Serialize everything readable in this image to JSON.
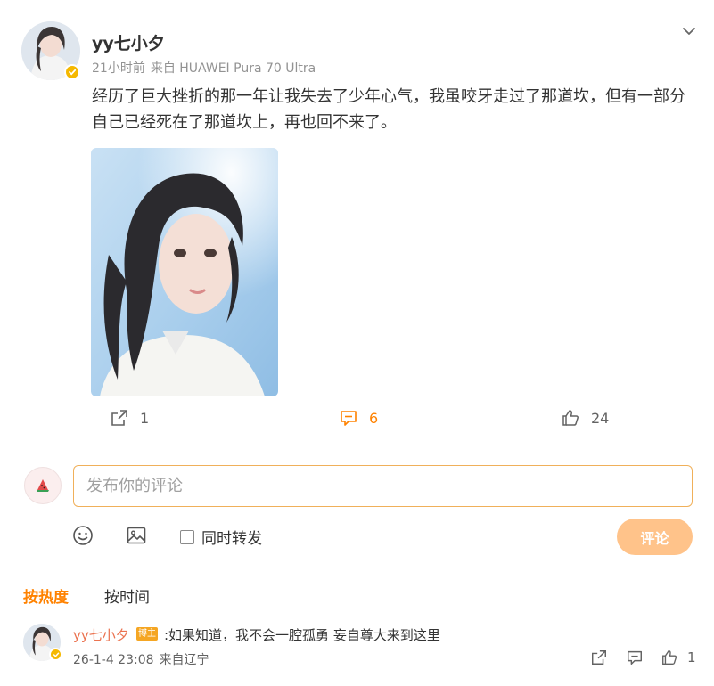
{
  "post": {
    "author": "yy七小夕",
    "time": "21小时前",
    "source": "来自 HUAWEI Pura 70 Ultra",
    "text": "经历了巨大挫折的那一年让我失去了少年心气，我虽咬牙走过了那道坎，但有一部分自己已经死在了那道坎上，再也回不来了。",
    "actions": {
      "repost_count": "1",
      "comment_count": "6",
      "like_count": "24"
    }
  },
  "composer": {
    "placeholder": "发布你的评论",
    "forward_label": "同时转发",
    "submit_label": "评论"
  },
  "sort_tabs": {
    "hot": "按热度",
    "time": "按时间"
  },
  "comments": [
    {
      "author": "yy七小夕",
      "badge": "博主",
      "text": ":如果知道，我不会一腔孤勇 妄自尊大来到这里",
      "date": "26-1-4 23:08",
      "location": "来自辽宁",
      "like_count": "1"
    }
  ],
  "colors": {
    "accent": "#ff8200",
    "name_link": "#eb7350",
    "meta": "#939393",
    "input_border": "#f0b05a",
    "submit_disabled": "#ffc38a",
    "verified": "#f5b800"
  },
  "icons": {
    "menu": "chevron-down-icon",
    "repost": "repost-icon",
    "comment": "comment-icon",
    "like": "thumbs-up-icon",
    "emoji": "smile-icon",
    "image": "image-icon",
    "verified": "verified-badge-icon",
    "user": "watermelon-avatar-icon"
  }
}
